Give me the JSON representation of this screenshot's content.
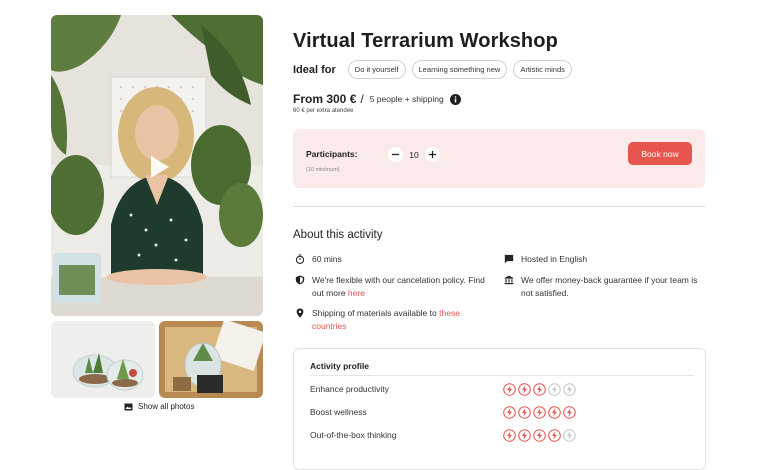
{
  "gallery": {
    "show_all_label": "Show all photos"
  },
  "product": {
    "title": "Virtual Terrarium Workshop",
    "ideal_for_label": "Ideal for",
    "tags": [
      "Do it yourself",
      "Learning something new",
      "Artistic minds"
    ],
    "price": "From 300 €",
    "price_slash": "/",
    "price_detail": "5 people + shipping",
    "extra_note": "60 € per extra atendee"
  },
  "booking": {
    "participants_label": "Participants:",
    "participants_value": "10",
    "minimum_note": "(10 minimum)",
    "book_label": "Book now"
  },
  "about": {
    "title": "About this activity",
    "duration": "60 mins",
    "language": "Hosted in English",
    "cancel_text": "We're flexible with our cancelation policy. Find out more",
    "cancel_link": "here",
    "guarantee": "We offer money-back guarantee if your team is not satisfied.",
    "shipping_text": "Shipping of materials available to",
    "shipping_link": "these countries"
  },
  "profile": {
    "title": "Activity profile",
    "max_rating": 5,
    "rows": [
      {
        "label": "Enhance productivity",
        "rating": 3
      },
      {
        "label": "Boost wellness",
        "rating": 5
      },
      {
        "label": "Out-of-the-box thinking",
        "rating": 4
      }
    ]
  },
  "colors": {
    "accent": "#e8554e",
    "booking_bg": "#fbeaea",
    "inactive_bolt": "#c4c4c4"
  },
  "icons": {
    "play": "play-icon",
    "gallery": "gallery-icon",
    "info": "info-icon",
    "minus": "minus-icon",
    "plus": "plus-icon",
    "duration": "stopwatch-icon",
    "language": "chat-bubble-icon",
    "policy": "shield-icon",
    "guarantee": "bank-icon",
    "shipping": "location-pin-icon",
    "rating": "lightning-bolt-icon"
  }
}
